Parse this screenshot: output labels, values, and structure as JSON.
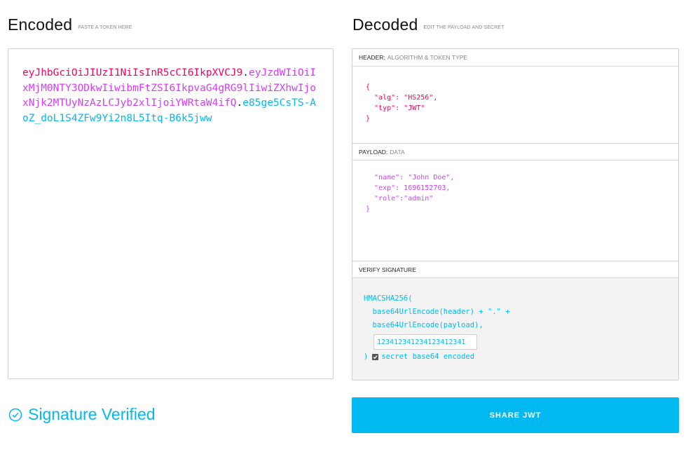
{
  "encoded": {
    "title": "Encoded",
    "hint": "PASTE A TOKEN HERE",
    "token_header": "eyJhbGciOiJIUzI1NiIsInR5cCI6IkpXVCJ9",
    "token_payload": "eyJzdWIiOiIxMjM0NTY3ODkwIiwibmFtZSI6IkpvaG4gRG9lIiwiZXhwIjoxNjk2MTUyNzAzLCJyb2xlIjoiYWRtaW4ifQ",
    "token_signature": "e85ge5CsTS-AoZ_doL1S4ZFw9Yi2n8L5Itq-B6k5jww",
    "dot": "."
  },
  "decoded": {
    "title": "Decoded",
    "hint": "EDIT THE PAYLOAD AND SECRET",
    "header": {
      "label": "HEADER:",
      "sublabel": "ALGORITHM & TOKEN TYPE",
      "json": "{\n  \"alg\": \"HS256\",\n  \"typ\": \"JWT\"\n}"
    },
    "payload": {
      "label": "PAYLOAD:",
      "sublabel": "DATA",
      "json": "  \"name\": \"John Doe\",\n  \"exp\": 1696152703,\n  \"role\":\"admin\"\n}"
    },
    "verify": {
      "label": "VERIFY SIGNATURE",
      "code": "HMACSHA256(\n  base64UrlEncode(header) + \".\" +\n  base64UrlEncode(payload),",
      "secret": "123412341234123412341",
      "close_paren": ")",
      "checkbox_label": "secret base64 encoded",
      "checkbox_checked": true
    }
  },
  "status": {
    "text": "Signature Verified",
    "color": "#00b9f1"
  },
  "share_button": {
    "label": "SHARE JWT"
  },
  "colors": {
    "header": "#fb015b",
    "payload": "#d63aff",
    "signature": "#00b9f1"
  }
}
